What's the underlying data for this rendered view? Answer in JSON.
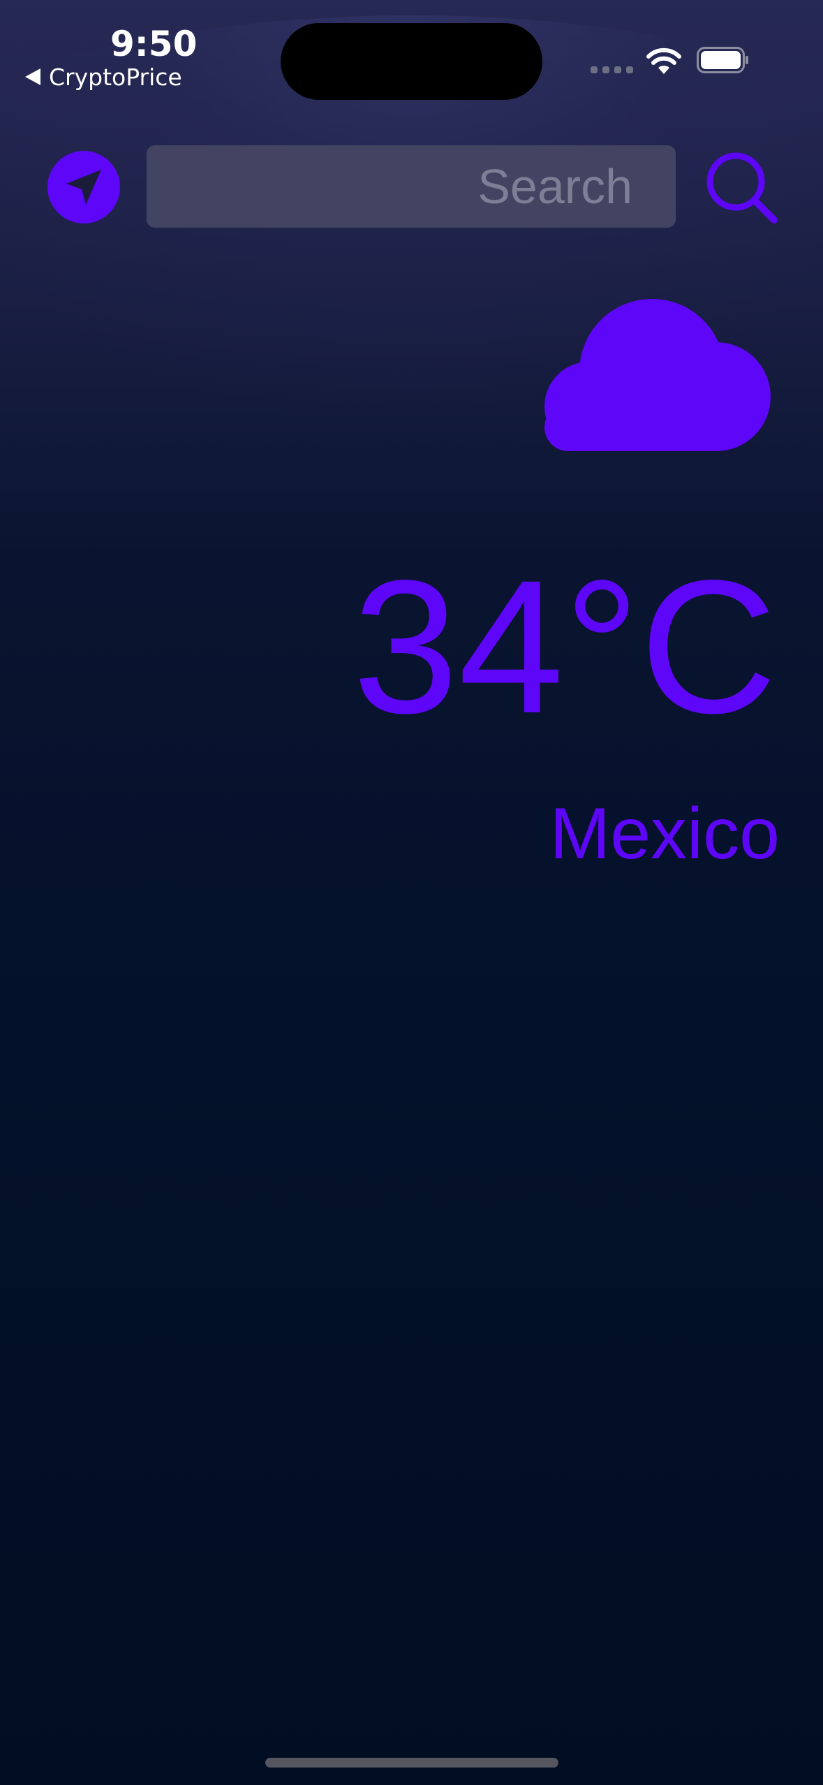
{
  "status_bar": {
    "time": "9:50",
    "back_app": "CryptoPrice"
  },
  "header": {
    "search": {
      "placeholder": "Search",
      "value": ""
    },
    "location_icon": "location-arrow-icon",
    "search_icon": "magnifying-glass-icon"
  },
  "weather": {
    "condition_icon": "cloud-icon",
    "temperature": "34°C",
    "city": "Mexico"
  },
  "colors": {
    "accent": "#5e06f7",
    "background_top": "#272955",
    "background_bottom": "#010d22",
    "search_field": "#424462"
  }
}
